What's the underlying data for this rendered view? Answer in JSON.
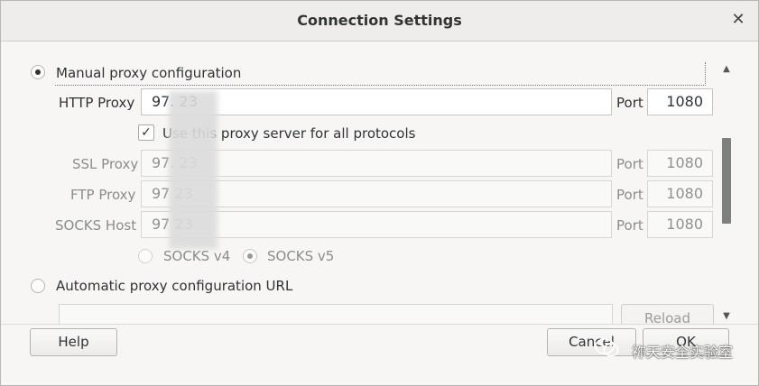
{
  "window": {
    "title": "Connection Settings"
  },
  "manual": {
    "label": "Manual proxy configuration",
    "selected": true
  },
  "http": {
    "label": "HTTP Proxy",
    "value": "97.         23",
    "port_label": "Port",
    "port": "1080"
  },
  "use_all": {
    "label": "Use this proxy server for all protocols",
    "checked": true
  },
  "ssl": {
    "label": "SSL Proxy",
    "value": "97.         23",
    "port_label": "Port",
    "port": "1080"
  },
  "ftp": {
    "label": "FTP Proxy",
    "value": "97         23",
    "port_label": "Port",
    "port": "1080"
  },
  "socks": {
    "label": "SOCKS Host",
    "value": "97         23",
    "port_label": "Port",
    "port": "1080"
  },
  "socks_v4": {
    "label": "SOCKS v4",
    "selected": false
  },
  "socks_v5": {
    "label": "SOCKS v5",
    "selected": true
  },
  "auto": {
    "label": "Automatic proxy configuration URL",
    "selected": false,
    "url": ""
  },
  "reload_label": "Reload",
  "buttons": {
    "help": "Help",
    "cancel": "Cancel",
    "ok": "OK"
  },
  "watermark": "祢天安全实验室"
}
